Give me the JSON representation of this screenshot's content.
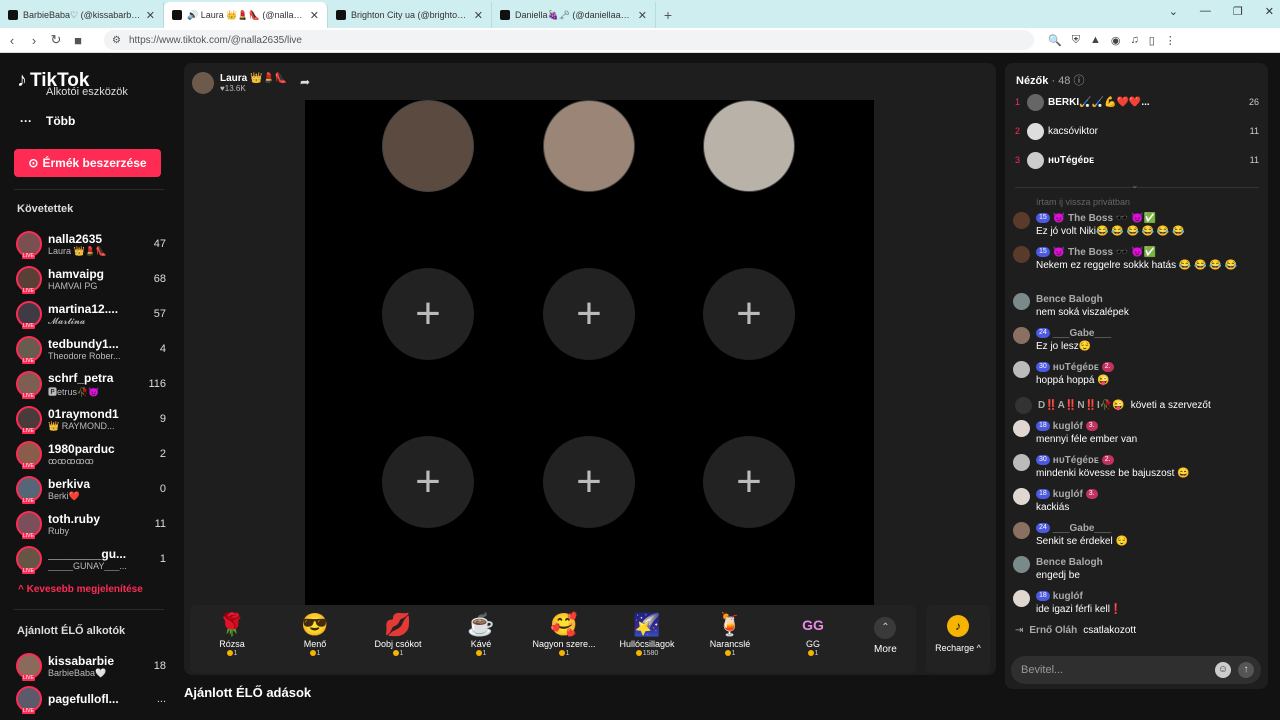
{
  "browser": {
    "tabs": [
      {
        "title": "BarbieBaba♡ (@kissabarbie) ÉL",
        "active": false
      },
      {
        "title": "🔊 Laura 👑💄👠 (@nalla2635) É",
        "active": true
      },
      {
        "title": "Brighton City ua (@brighton.city) ÉL",
        "active": false
      },
      {
        "title": "Daniella🍇🗝️ (@daniellaaaa05) ÉL",
        "active": false
      }
    ],
    "new_tab": "+",
    "url": "https://www.tiktok.com/@nalla2635/live",
    "window_controls": [
      "⌄",
      "—",
      "❐",
      "✕"
    ]
  },
  "sidebar": {
    "logo": "TikTok",
    "tools_label": "Alkotói eszközök",
    "more_label": "Több",
    "coins_button": "Érmék beszerzése",
    "following_header": "Követettek",
    "following": [
      {
        "name": "nalla2635",
        "sub": "Laura 👑💄👠",
        "count": "47"
      },
      {
        "name": "hamvaipg",
        "sub": "HAMVAI PG",
        "count": "68"
      },
      {
        "name": "martina12....",
        "sub": "𝓜𝓪𝓻𝓽𝓲𝓷𝓪",
        "count": "57"
      },
      {
        "name": "tedbundy1...",
        "sub": "Theodore Rober...",
        "count": "4"
      },
      {
        "name": "schrf_petra",
        "sub": "🅿etrus🥀😈",
        "count": "116"
      },
      {
        "name": "01raymond1",
        "sub": "👑 RAYMOND...",
        "count": "9"
      },
      {
        "name": "1980parduc",
        "sub": "ꝏꝏꝏꝏꝏ",
        "count": "2"
      },
      {
        "name": "berkiva",
        "sub": "Berki❤️",
        "count": "0"
      },
      {
        "name": "toth.ruby",
        "sub": "Ruby",
        "count": "11"
      },
      {
        "name": "________gu...",
        "sub": "_____GUNAY___...",
        "count": "1"
      }
    ],
    "show_less": "Kevesebb megjelenítése",
    "recommended_header": "Ajánlott ÉLŐ alkotók",
    "recommended": [
      {
        "name": "kissabarbie",
        "sub": "BarbieBaba🤍",
        "count": "18"
      },
      {
        "name": "pagefullofl...",
        "sub": "",
        "count": "..."
      }
    ]
  },
  "stream": {
    "host_name": "Laura 👑💄👠",
    "host_likes": "♥13.6K",
    "share_icon": "share-icon",
    "empty_slot": "+",
    "gifts": [
      {
        "icon": "🌹",
        "name": "Rózsa",
        "price": "1"
      },
      {
        "icon": "😎",
        "name": "Menő",
        "price": "1"
      },
      {
        "icon": "💋",
        "name": "Dobj csókot",
        "price": "1"
      },
      {
        "icon": "☕",
        "name": "Kávé",
        "price": "1"
      },
      {
        "icon": "🥰",
        "name": "Nagyon szere...",
        "price": "1"
      },
      {
        "icon": "🌠",
        "name": "Hullócsillagok",
        "price": "1580"
      },
      {
        "icon": "🍹",
        "name": "Narancslé",
        "price": "1"
      },
      {
        "icon": "GG",
        "name": "GG",
        "price": "1"
      }
    ],
    "more_label": "More",
    "recharge_label": "Recharge ^",
    "recommended_live": "Ajánlott ÉLŐ adások"
  },
  "viewers": {
    "header": "Nézők",
    "count": "· 48",
    "top": [
      {
        "rank": "1",
        "name": "BERKI🏑🏑💪❤️❤️...",
        "count": "26"
      },
      {
        "rank": "2",
        "name": "kacsóviktor",
        "count": "11"
      },
      {
        "rank": "3",
        "name": "ʜᴜTégéᴅᴇ",
        "count": "11"
      }
    ]
  },
  "chat": {
    "partial": "írtam ij vissza privátban",
    "messages": [
      {
        "level": "15",
        "user": "😈 The Boss 🕶️ 😈✅",
        "tag": "",
        "text": "Ez jó volt Niki😂 😂 😂 😂 😂 😂"
      },
      {
        "level": "15",
        "user": "😈 The Boss 🕶️ 😈✅",
        "tag": "",
        "text": "Nekem ez reggelre sokkk hatás 😂 😂 😂 😂"
      },
      {
        "level": "",
        "user": "Bence Balogh",
        "tag": "",
        "text": "nem soká viszalépek"
      },
      {
        "level": "24",
        "user": "___Gabe___",
        "tag": "",
        "text": "Ez jo lesz😌"
      },
      {
        "level": "30",
        "user": "ʜᴜTégéᴅᴇ",
        "tag": "2.",
        "text": "hoppá hoppá 😜"
      },
      {
        "level": "18",
        "user": "kuglóf",
        "tag": "3.",
        "text": "mennyi féle ember van"
      },
      {
        "level": "30",
        "user": "ʜᴜTégéᴅᴇ",
        "tag": "2.",
        "text": "mindenki kövesse be bajuszost 😄"
      },
      {
        "level": "18",
        "user": "kuglóf",
        "tag": "3.",
        "text": "kackiás"
      },
      {
        "level": "24",
        "user": "___Gabe___",
        "tag": "",
        "text": "Senkit se érdekel 😌"
      },
      {
        "level": "",
        "user": "Bence Balogh",
        "tag": "",
        "text": "engedj be"
      },
      {
        "level": "18",
        "user": "kuglóf",
        "tag": "",
        "text": "ide igazi férfi kell❗"
      }
    ],
    "follow_event": {
      "user": "D‼️A‼️N‼️I🥀😜",
      "text": "követi a szervezőt"
    },
    "join_event": {
      "user": "Ernő Oláh",
      "text": "csatlakozott"
    },
    "input_placeholder": "Bevitel..."
  }
}
